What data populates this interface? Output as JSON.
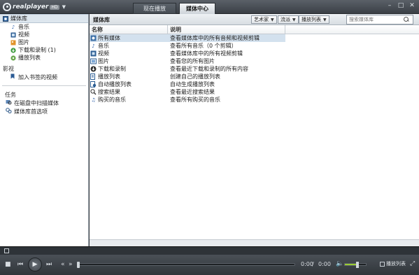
{
  "titlebar": {
    "brand": "realplayer",
    "badge": "HD",
    "tabs": [
      {
        "label": "现在播放"
      },
      {
        "label": "媒体中心"
      }
    ],
    "window_buttons": [
      "–",
      "□",
      "✕"
    ]
  },
  "sidebar": {
    "library_label": "媒体库",
    "library_items": [
      {
        "label": "音乐",
        "icon": "music-note-icon"
      },
      {
        "label": "视频",
        "icon": "video-icon"
      },
      {
        "label": "图片",
        "icon": "picture-icon"
      },
      {
        "label": "下载和录制 (1)",
        "icon": "download-icon"
      },
      {
        "label": "播放列表",
        "icon": "playlist-icon"
      }
    ],
    "video_section_label": "影视",
    "video_items": [
      {
        "label": "加入书签的视频",
        "icon": "bookmark-icon"
      }
    ],
    "tasks_label": "任务",
    "task_items": [
      {
        "label": "在磁盘中扫描媒体",
        "icon": "scan-disk-icon"
      },
      {
        "label": "媒体库首选项",
        "icon": "preferences-icon"
      }
    ]
  },
  "main": {
    "toolbar_title": "媒体库",
    "dropdowns": [
      {
        "label": "艺术家"
      },
      {
        "label": "流派"
      },
      {
        "label": "播放列表"
      }
    ],
    "search_placeholder": "搜索媒体库",
    "columns": {
      "name": "名称",
      "desc": "说明"
    },
    "rows": [
      {
        "name": "所有媒体",
        "desc": "查看媒体库中的所有音频和视频剪辑",
        "icon": "all-media-icon",
        "selected": true
      },
      {
        "name": "音乐",
        "desc": "查看所有音乐（0 个剪辑）",
        "icon": "music-note-icon"
      },
      {
        "name": "视频",
        "desc": "查看媒体库中的所有视频剪辑",
        "icon": "video-icon"
      },
      {
        "name": "图片",
        "desc": "查看您的所有图片",
        "icon": "picture-icon"
      },
      {
        "name": "下载和录制",
        "desc": "查看最近下载和录制的所有内容",
        "icon": "download-icon"
      },
      {
        "name": "播放列表",
        "desc": "创建自己的播放列表",
        "icon": "playlist-icon"
      },
      {
        "name": "自动播放列表",
        "desc": "自动生成播放列表",
        "icon": "auto-playlist-icon"
      },
      {
        "name": "搜索结果",
        "desc": "查看最近搜索结果",
        "icon": "search-icon"
      },
      {
        "name": "购买的音乐",
        "desc": "查看所有购买的音乐",
        "icon": "purchased-music-icon"
      }
    ]
  },
  "transport": {
    "time_current": "0:00",
    "time_sep": "/",
    "time_total": "0:00",
    "playlist_toggle_label": "播放列表",
    "volume_level": 0.6,
    "seek_position": 0
  },
  "colors": {
    "selection": "#d3e1ee",
    "chrome_dark": "#3a3f45",
    "volume_green": "#9acd32"
  }
}
